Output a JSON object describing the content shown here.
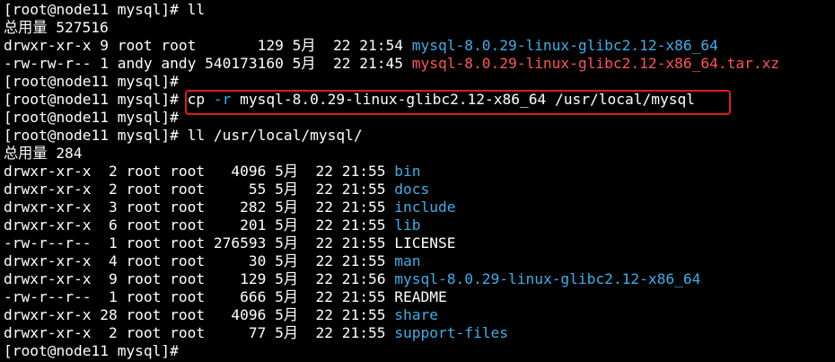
{
  "colors": {
    "background": "#000000",
    "default_text": "#ffffff",
    "directory": "#3daee9",
    "archive": "#ff5555",
    "highlight_border": "#e01b1b"
  },
  "lines": [
    {
      "type": "prompt",
      "segments": [
        {
          "text": "[root@node11 mysql]# ll",
          "color": "#ffffff"
        }
      ]
    },
    {
      "type": "total",
      "segments": [
        {
          "text": "总用量 527516",
          "color": "#ffffff"
        }
      ]
    },
    {
      "type": "entry",
      "segments": [
        {
          "text": "drwxr-xr-x 9 root root       129 5月  22 21:54 ",
          "color": "#ffffff"
        },
        {
          "text": "mysql-8.0.29-linux-glibc2.12-x86_64",
          "color": "#3daee9"
        }
      ]
    },
    {
      "type": "entry",
      "segments": [
        {
          "text": "-rw-rw-r-- 1 andy andy 540173160 5月  22 21:45 ",
          "color": "#ffffff"
        },
        {
          "text": "mysql-8.0.29-linux-glibc2.12-x86_64.tar.xz",
          "color": "#ff5555"
        }
      ]
    },
    {
      "type": "prompt",
      "segments": [
        {
          "text": "[root@node11 mysql]#",
          "color": "#ffffff"
        }
      ]
    },
    {
      "type": "prompt-highlighted",
      "segments": [
        {
          "text": "[root@node11 mysql]# ",
          "color": "#ffffff"
        },
        {
          "text": "cp ",
          "color": "#ffffff"
        },
        {
          "text": "-r",
          "color": "#3daee9"
        },
        {
          "text": " mysql-8.0.29-linux-glibc2.12-x86_64 /usr/local/mysql",
          "color": "#ffffff"
        }
      ]
    },
    {
      "type": "prompt",
      "segments": [
        {
          "text": "[root@node11 mysql]#",
          "color": "#ffffff"
        }
      ]
    },
    {
      "type": "prompt",
      "segments": [
        {
          "text": "[root@node11 mysql]# ll /usr/local/mysql/",
          "color": "#ffffff"
        }
      ]
    },
    {
      "type": "total",
      "segments": [
        {
          "text": "总用量 284",
          "color": "#ffffff"
        }
      ]
    },
    {
      "type": "entry",
      "segments": [
        {
          "text": "drwxr-xr-x  2 root root   4096 5月  22 21:55 ",
          "color": "#ffffff"
        },
        {
          "text": "bin",
          "color": "#3daee9"
        }
      ]
    },
    {
      "type": "entry",
      "segments": [
        {
          "text": "drwxr-xr-x  2 root root     55 5月  22 21:55 ",
          "color": "#ffffff"
        },
        {
          "text": "docs",
          "color": "#3daee9"
        }
      ]
    },
    {
      "type": "entry",
      "segments": [
        {
          "text": "drwxr-xr-x  3 root root    282 5月  22 21:55 ",
          "color": "#ffffff"
        },
        {
          "text": "include",
          "color": "#3daee9"
        }
      ]
    },
    {
      "type": "entry",
      "segments": [
        {
          "text": "drwxr-xr-x  6 root root    201 5月  22 21:55 ",
          "color": "#ffffff"
        },
        {
          "text": "lib",
          "color": "#3daee9"
        }
      ]
    },
    {
      "type": "entry",
      "segments": [
        {
          "text": "-rw-r--r--  1 root root 276593 5月  22 21:55 ",
          "color": "#ffffff"
        },
        {
          "text": "LICENSE",
          "color": "#ffffff"
        }
      ]
    },
    {
      "type": "entry",
      "segments": [
        {
          "text": "drwxr-xr-x  4 root root     30 5月  22 21:55 ",
          "color": "#ffffff"
        },
        {
          "text": "man",
          "color": "#3daee9"
        }
      ]
    },
    {
      "type": "entry",
      "segments": [
        {
          "text": "drwxr-xr-x  9 root root    129 5月  22 21:56 ",
          "color": "#ffffff"
        },
        {
          "text": "mysql-8.0.29-linux-glibc2.12-x86_64",
          "color": "#3daee9"
        }
      ]
    },
    {
      "type": "entry",
      "segments": [
        {
          "text": "-rw-r--r--  1 root root    666 5月  22 21:55 ",
          "color": "#ffffff"
        },
        {
          "text": "README",
          "color": "#ffffff"
        }
      ]
    },
    {
      "type": "entry",
      "segments": [
        {
          "text": "drwxr-xr-x 28 root root   4096 5月  22 21:55 ",
          "color": "#ffffff"
        },
        {
          "text": "share",
          "color": "#3daee9"
        }
      ]
    },
    {
      "type": "entry",
      "segments": [
        {
          "text": "drwxr-xr-x  2 root root     77 5月  22 21:55 ",
          "color": "#ffffff"
        },
        {
          "text": "support-files",
          "color": "#3daee9"
        }
      ]
    },
    {
      "type": "prompt",
      "segments": [
        {
          "text": "[root@node11 mysql]#",
          "color": "#ffffff"
        }
      ]
    }
  ]
}
